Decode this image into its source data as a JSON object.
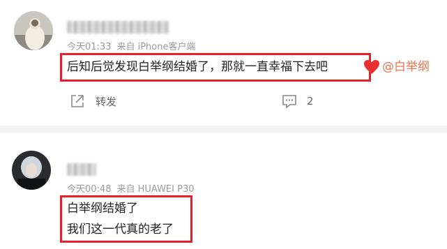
{
  "posts": [
    {
      "time": "今天01:33",
      "source": "来自 iPhone客户端",
      "text": "后知后觉发现白举纲结婚了，那就一直幸福下去吧",
      "mention": "@白举纲",
      "actions": {
        "repost": "转发",
        "comments": "2"
      }
    },
    {
      "time": "今天00:48",
      "source": "来自 HUAWEI P30",
      "lines": [
        "白举纲结婚了",
        "我们这一代真的老了"
      ]
    }
  ],
  "colors": {
    "highlight_border": "#e8202e",
    "mention": "#eb7350",
    "heart": "#e8322f"
  }
}
